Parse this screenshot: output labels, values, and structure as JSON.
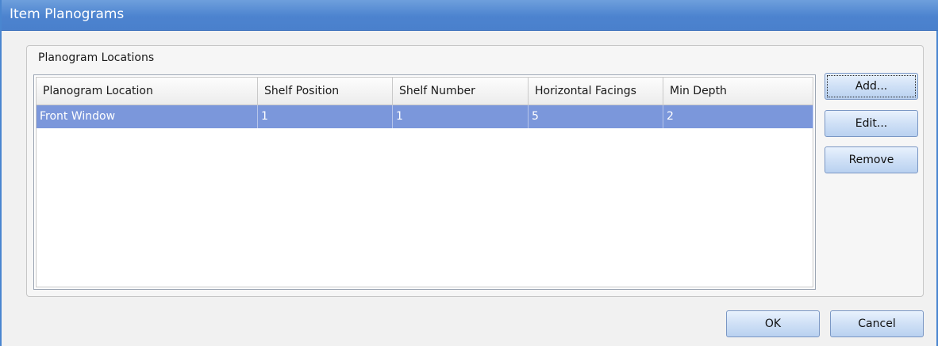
{
  "window": {
    "title": "Item Planograms"
  },
  "group": {
    "label": "Planogram Locations"
  },
  "table": {
    "columns": [
      "Planogram Location",
      "Shelf Position",
      "Shelf Number",
      "Horizontal Facings",
      "Min Depth"
    ],
    "rows": [
      [
        "Front Window",
        "1",
        "1",
        "5",
        "2"
      ]
    ],
    "selected_row_color": "#7b97db"
  },
  "buttons": {
    "add": "Add...",
    "edit": "Edit...",
    "remove": "Remove",
    "ok": "OK",
    "cancel": "Cancel"
  },
  "colors": {
    "titlebar": "#4c83cf",
    "window_border": "#4a86d0"
  }
}
